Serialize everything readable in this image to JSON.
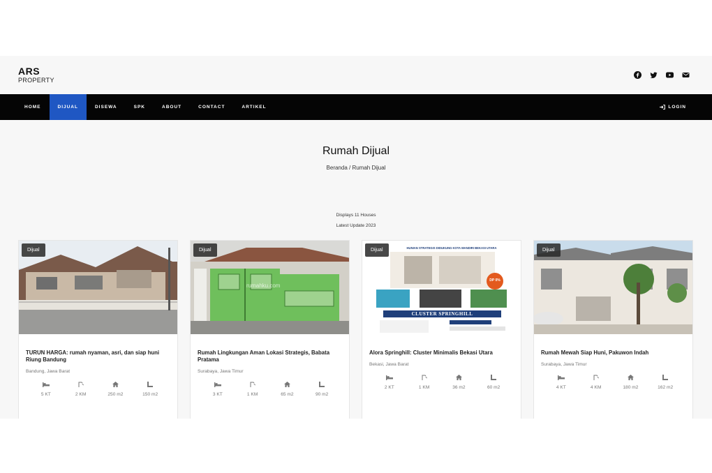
{
  "brand": {
    "line1": "ARS",
    "line2": "PROPERTY"
  },
  "social": [
    "facebook-icon",
    "twitter-icon",
    "youtube-icon",
    "email-icon"
  ],
  "nav": {
    "items": [
      {
        "label": "HOME"
      },
      {
        "label": "DIJUAL"
      },
      {
        "label": "DISEWA"
      },
      {
        "label": "SPK"
      },
      {
        "label": "ABOUT"
      },
      {
        "label": "CONTACT"
      },
      {
        "label": "ARTIKEL"
      }
    ],
    "active": "DIJUAL",
    "login_label": "LOGIN"
  },
  "hero": {
    "title": "Rumah Dijual",
    "breadcrumb": "Beranda / Rumah Dijual"
  },
  "listing_meta": {
    "count_text": "Displays 11 Houses",
    "update_text": "Latest Update 2023"
  },
  "cards": [
    {
      "badge": "Dijual",
      "title": "TURUN HARGA: rumah nyaman, asri, dan siap huni Riung Bandung",
      "location": "Bandung, Jawa Barat",
      "specs": [
        "5 KT",
        "2 KM",
        "250 m2",
        "150 m2"
      ]
    },
    {
      "badge": "Dijual",
      "title": "Rumah Lingkungan Aman Lokasi Strategis, Babata Pratama",
      "location": "Surabaya, Jawa Timur",
      "specs": [
        "3 KT",
        "1 KM",
        "65 m2",
        "90 m2"
      ]
    },
    {
      "badge": "Dijual",
      "title": "Alora Springhill: Cluster Minimalis Bekasi Utara",
      "location": "Bekasi, Jawa Barat",
      "specs": [
        "2 KT",
        "1 KM",
        "36 m2",
        "60 m2"
      ]
    },
    {
      "badge": "Dijual",
      "title": "Rumah Mewah Siap Huni, Pakuwon Indah",
      "location": "Surabaya, Jawa Timur",
      "specs": [
        "4 KT",
        "4 KM",
        "180 m2",
        "162 m2"
      ]
    }
  ],
  "spec_icons": [
    "bed-icon",
    "bath-icon",
    "building-area-icon",
    "land-area-icon"
  ],
  "image_text": {
    "watermark": "rumahku.com",
    "poster_head": "HUNIAN STRATEGIS DIDUKUNG KOTA MANDIRI BEKASI UTARA",
    "poster_title": "CLUSTER SPRINGHILL",
    "promo": "DP 0%"
  },
  "colors": {
    "accent": "#1f57c3",
    "navbar": "#050505",
    "page_bg": "#f7f7f7"
  }
}
